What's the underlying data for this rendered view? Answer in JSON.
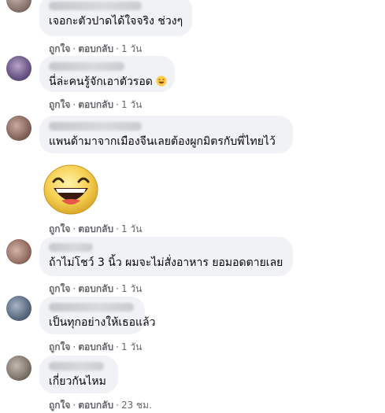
{
  "comments": [
    {
      "text": "เจอกะตัวปาดได้ใจจริง ช่วงๆ",
      "like": "ถูกใจ",
      "reply": "ตอบกลับ",
      "time": "1 วัน"
    },
    {
      "text": "นี่ล่ะคนรู้จักเอาตัวรอด",
      "emoji": "laughing-emoji",
      "like": "ถูกใจ",
      "reply": "ตอบกลับ",
      "time": "1 วัน"
    },
    {
      "text": "แพนด้ามาจากเมืองจีนเลยต้องผูกมิตรกับพี่ไทยไว้",
      "sticker": "laughing-face-sticker",
      "like": "ถูกใจ",
      "reply": "ตอบกลับ",
      "time": "1 วัน"
    },
    {
      "text": "ถ้าไม่โชว์ 3 นิ้ว ผมจะไม่สั่งอาหาร ยอมอดตายเลย",
      "like": "ถูกใจ",
      "reply": "ตอบกลับ",
      "time": "1 วัน"
    },
    {
      "text": "เป็นทุกอย่างให้เธอแล้ว",
      "like": "ถูกใจ",
      "reply": "ตอบกลับ",
      "time": "1 วัน"
    },
    {
      "text": "เกี่ยวกันไหม",
      "like": "ถูกใจ",
      "reply": "ตอบกลับ",
      "time": "23 ชม."
    }
  ],
  "separator": "·",
  "colors": {
    "bubble": "#f0f2f5",
    "meta": "#65676b",
    "text": "#050505"
  }
}
